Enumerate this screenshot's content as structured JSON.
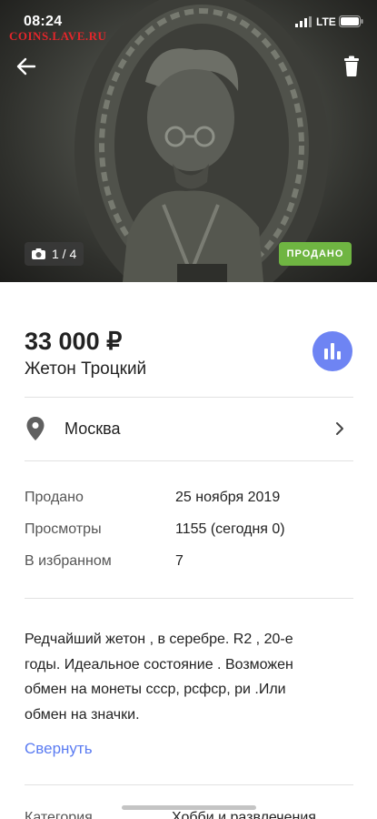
{
  "status_bar": {
    "time": "08:24",
    "network": "LTE",
    "watermark": "COINS.LAVE.RU"
  },
  "hero": {
    "photo_counter": "1 / 4",
    "sold_badge": "ПРОДАНО",
    "icons": {
      "back": "arrow-left-icon",
      "delete": "trash-icon",
      "camera": "camera-icon"
    }
  },
  "listing": {
    "price": "33 000 ₽",
    "title": "Жетон Троцкий",
    "location": "Москва",
    "details": [
      {
        "label": "Продано",
        "value": "25 ноября 2019"
      },
      {
        "label": "Просмотры",
        "value": "1155 (сегодня 0)"
      },
      {
        "label": "В избранном",
        "value": "7"
      }
    ],
    "description_lines": [
      "Редчайший жетон , в серебре. R2 , 20-е",
      "годы. Идеальное состояние . Возможен",
      "обмен на монеты ссср, рсфср, ри .Или",
      "обмен на значки."
    ],
    "collapse_label": "Свернуть",
    "category": {
      "label": "Категория",
      "value": "Хобби и развлечения"
    }
  },
  "colors": {
    "accent_blue": "#5b7cf2",
    "stats_button": "#6e84f3",
    "sold_green": "#6fb542",
    "watermark_red": "#e3262b"
  }
}
